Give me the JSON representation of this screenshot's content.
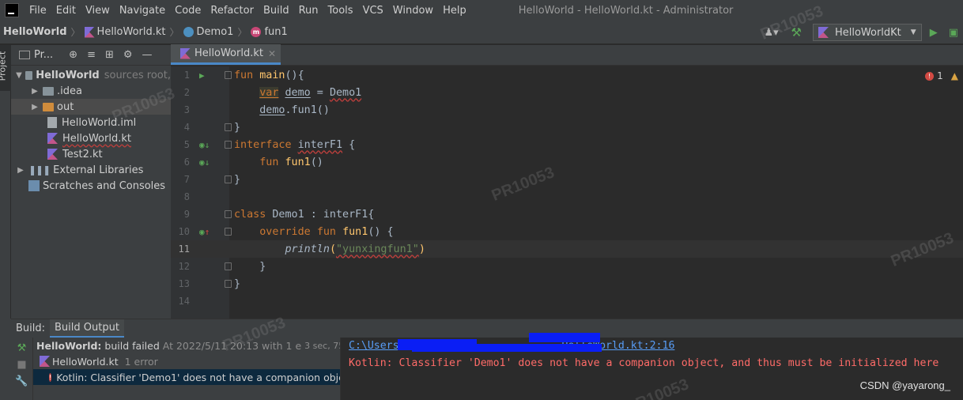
{
  "menu": {
    "items": [
      "File",
      "Edit",
      "View",
      "Navigate",
      "Code",
      "Refactor",
      "Build",
      "Run",
      "Tools",
      "VCS",
      "Window",
      "Help"
    ],
    "window_title": "HelloWorld - HelloWorld.kt - Administrator"
  },
  "breadcrumb": {
    "project": "HelloWorld",
    "file": "HelloWorld.kt",
    "class": "Demo1",
    "function": "fun1"
  },
  "toolbar": {
    "run_config": "HelloWorldKt"
  },
  "project_panel": {
    "title": "Pr...",
    "side_tab": "Project",
    "root_name": "HelloWorld",
    "root_hint": "sources root,",
    "items": [
      ".idea",
      "out",
      "HelloWorld.iml",
      "HelloWorld.kt",
      "Test2.kt"
    ],
    "external_libraries": "External Libraries",
    "scratches": "Scratches and Consoles"
  },
  "editor": {
    "tab_label": "HelloWorld.kt",
    "error_count": "1",
    "line_numbers": [
      "1",
      "2",
      "3",
      "4",
      "5",
      "6",
      "7",
      "8",
      "9",
      "10",
      "11",
      "12",
      "13",
      "14"
    ],
    "code": {
      "l1": {
        "kw": "fun",
        "name": "main",
        "rest": "(){"
      },
      "l2": {
        "kw": "var",
        "name": "demo",
        "rest": " = ",
        "value": "Demo1"
      },
      "l3": {
        "name": "demo",
        "rest": ".fun1()"
      },
      "l4": {
        "text": "}"
      },
      "l5": {
        "kw": "interface",
        "name": "interF1",
        "rest": " {"
      },
      "l6": {
        "kw": "fun",
        "name": "fun1",
        "rest": "()"
      },
      "l7": {
        "text": "}"
      },
      "l9": {
        "kw": "class",
        "name": "Demo1",
        "rest": " : interF1{"
      },
      "l10": {
        "kw1": "override",
        "kw2": "fun",
        "name": "fun1",
        "rest": "() {"
      },
      "l11": {
        "fn": "println",
        "open": "(",
        "str": "\"yunxingfun1\"",
        "close": ")"
      },
      "l12": {
        "text": "}"
      },
      "l13": {
        "text": "}"
      }
    }
  },
  "build": {
    "label": "Build:",
    "tab": "Build Output",
    "rows": {
      "status_project": "HelloWorld:",
      "status_text": "build failed",
      "status_meta": "At 2022/5/11 20:13 with 1 e",
      "status_time": "3 sec, 759 ms",
      "file": "HelloWorld.kt",
      "file_meta": "1 error",
      "error": "Kotlin: Classifier 'Demo1' does not have a companion objec"
    },
    "console": {
      "link_start": "C:\\Users\\",
      "link_end": "HelloWorld.kt:2:16",
      "error": "Kotlin: Classifier 'Demo1' does not have a companion object, and thus must be initialized here"
    }
  },
  "credit": "CSDN @yayarong_",
  "watermark": "PR10053"
}
